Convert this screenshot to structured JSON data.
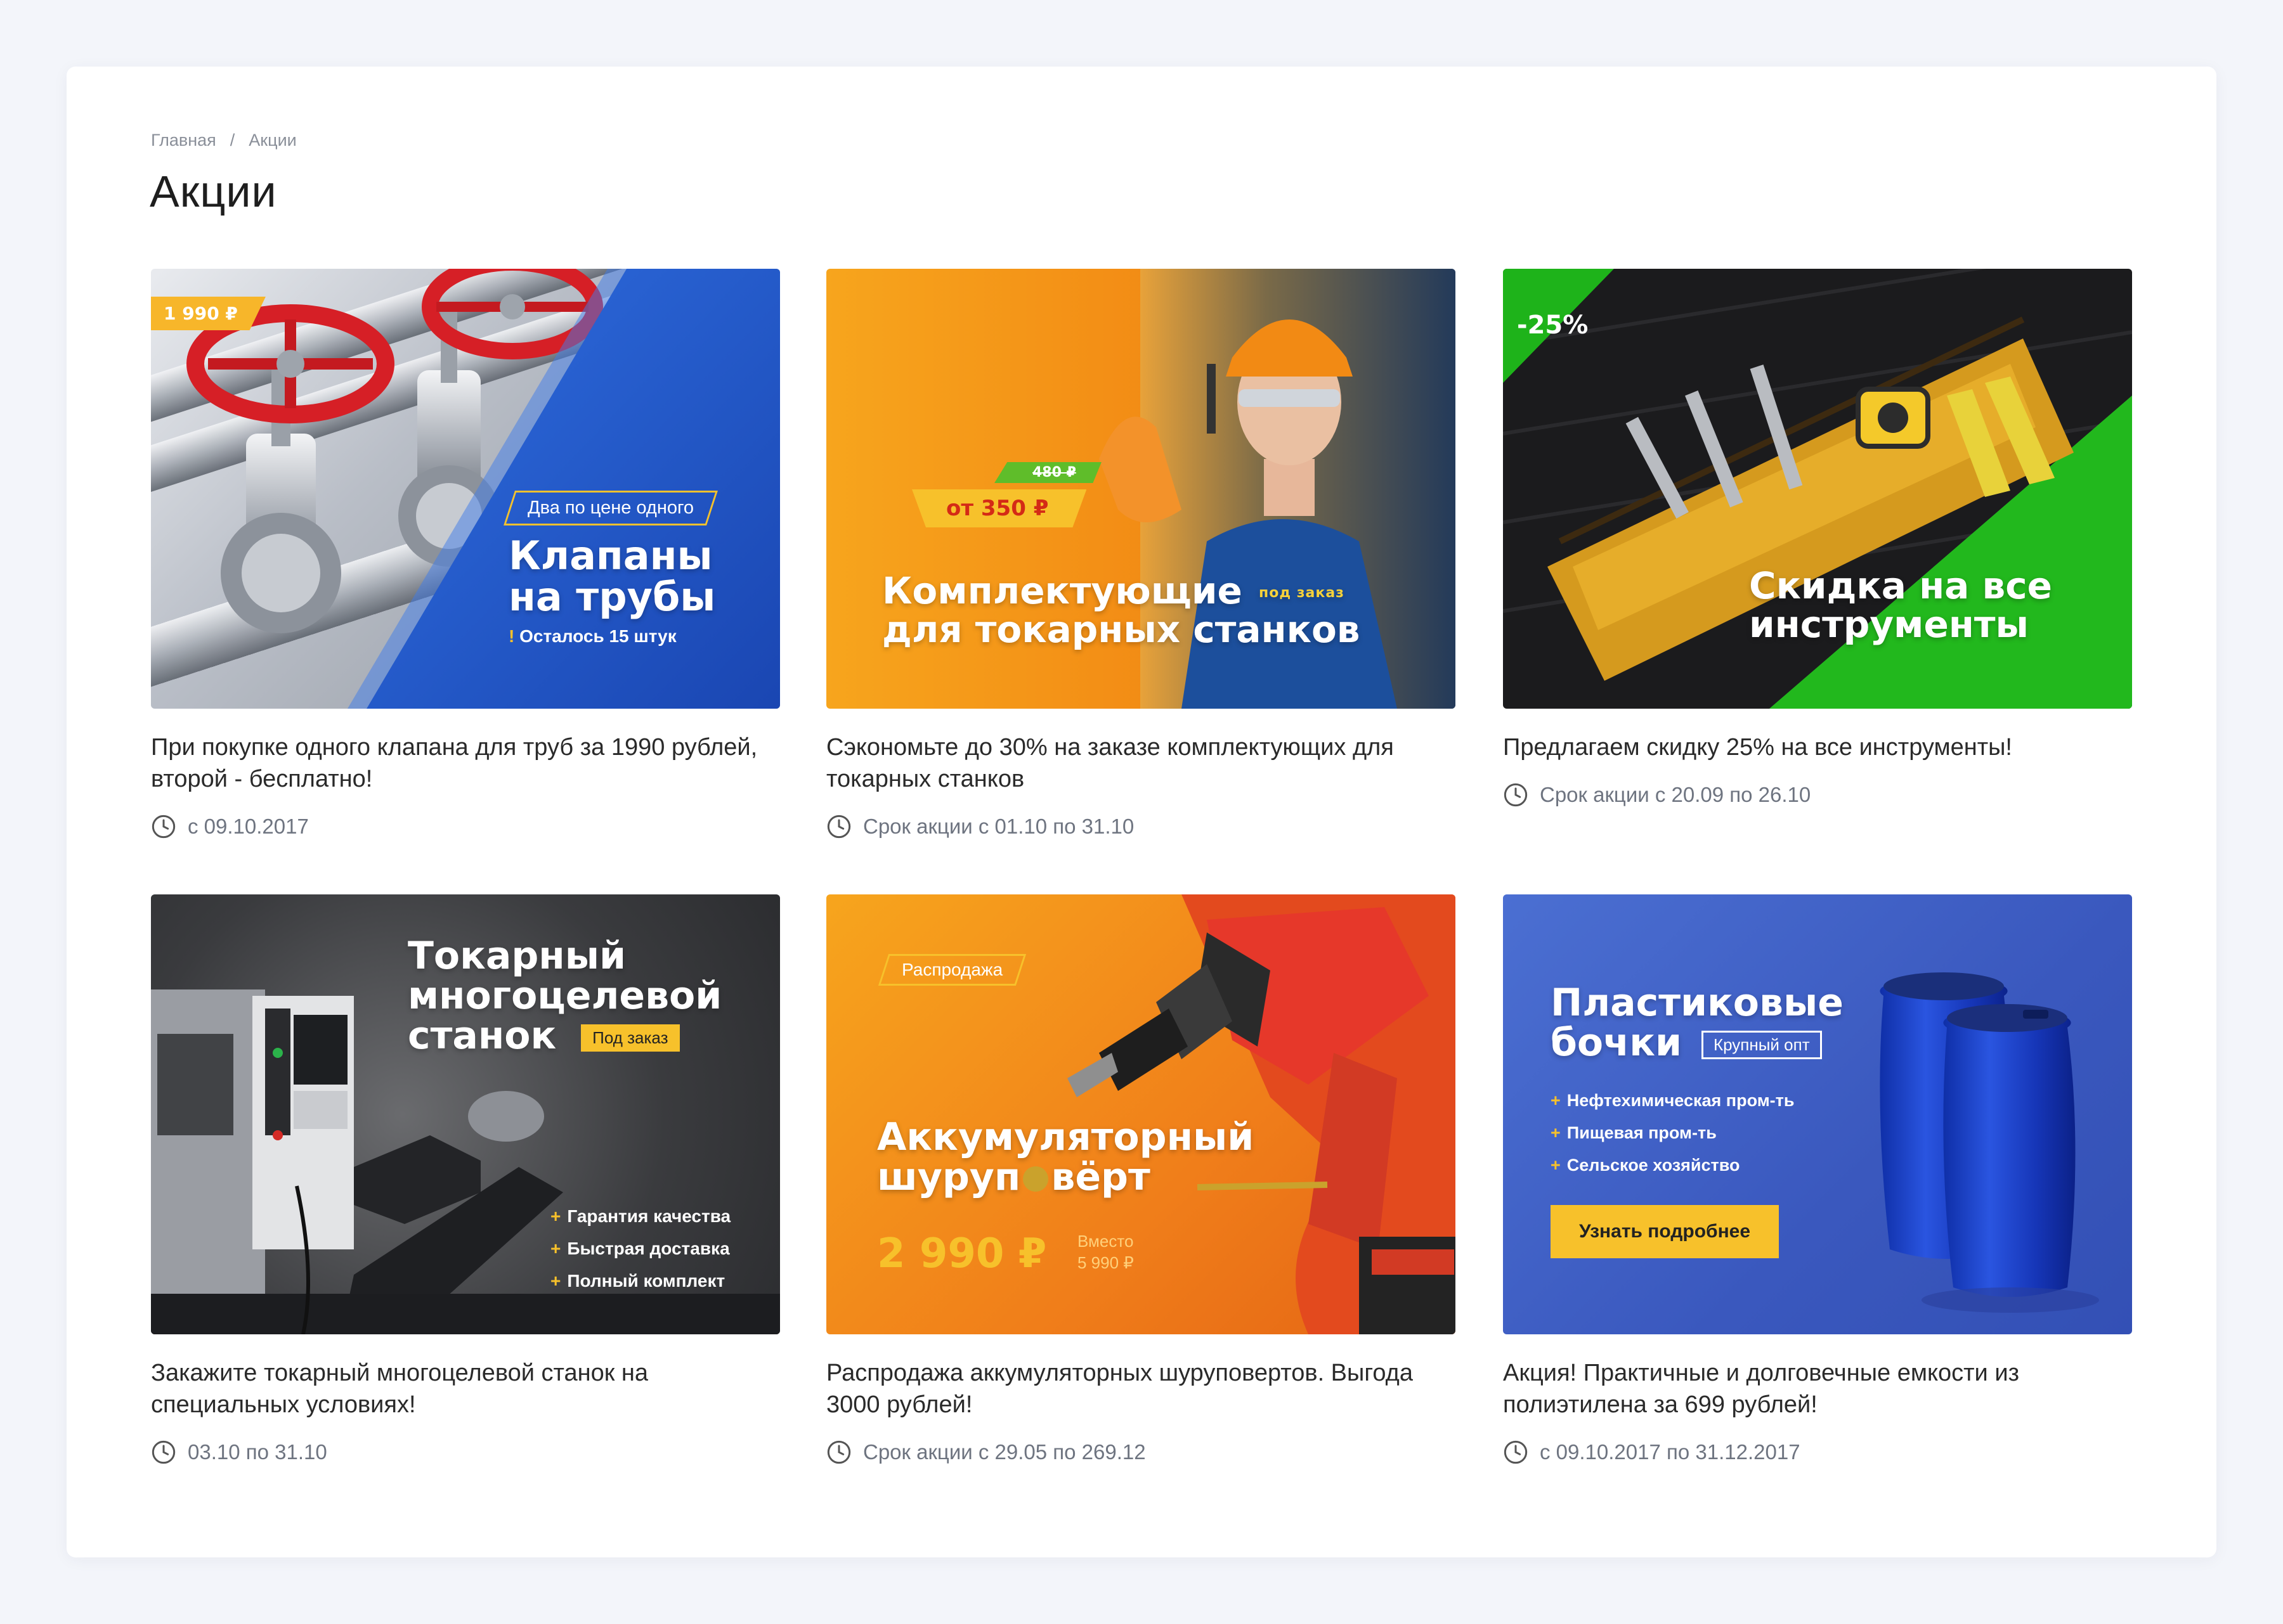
{
  "breadcrumb": {
    "home": "Главная",
    "separator": "/",
    "current": "Акции"
  },
  "page_title": "Акции",
  "promos": [
    {
      "banner": {
        "price_tag": "1 990 ₽",
        "badge": "Два по цене одного",
        "headline1": "Клапаны",
        "headline2": "на трубы",
        "note_mark": "!",
        "note": "Осталось 15 штук"
      },
      "description": "При покупке одного клапана для труб за 1990 рублей, второй - бесплатно!",
      "date": "с 09.10.2017"
    },
    {
      "banner": {
        "old_price": "480 ₽",
        "price": "от 350 ₽",
        "headline1": "Комплектующие",
        "order_tag": "под заказ",
        "headline2": "для токарных станков"
      },
      "description": "Сэкономьте до 30% на заказе комплектующих для токарных станков",
      "date": "Срок акции с 01.10 по 31.10"
    },
    {
      "banner": {
        "discount": "-25%",
        "headline1": "Скидка на все",
        "headline2": "инструменты"
      },
      "description": "Предлагаем скидку 25% на все инструменты!",
      "date": "Срок акции с 20.09 по 26.10"
    },
    {
      "banner": {
        "headline1": "Токарный",
        "headline2": "многоцелевой",
        "headline3": "станок",
        "order_tag": "Под заказ",
        "bullets": [
          "Гарантия качества",
          "Быстрая доставка",
          "Полный комплект"
        ]
      },
      "description": "Закажите токарный многоцелевой станок на специальных условиях!",
      "date": "03.10 по 31.10"
    },
    {
      "banner": {
        "badge": "Распродажа",
        "headline1": "Аккумуляторный",
        "headline2a": "шуруп",
        "headline2b": "вёрт",
        "price": "2 990 ₽",
        "instead_label": "Вместо",
        "instead_price": "5 990 ₽"
      },
      "description": "Распродажа аккумуляторных шуруповертов. Выгода 3000 рублей!",
      "date": "Срок акции с 29.05 по 269.12"
    },
    {
      "banner": {
        "headline1": "Пластиковые",
        "headline2": "бочки",
        "tag": "Крупный опт",
        "bullets": [
          "Нефтехимическая пром-ть",
          "Пищевая пром-ть",
          "Сельское хозяйство"
        ],
        "button": "Узнать подробнее"
      },
      "description": "Акция! Практичные и долговечные емкости из полиэтилена за 699 рублей!",
      "date": "с 09.10.2017 по 31.12.2017"
    }
  ],
  "colors": {
    "page_bg": "#f3f5fa",
    "accent_yellow": "#f7b62a",
    "blue_banner": "#1f58c9",
    "orange_banner": "#f39a1d",
    "green_banner": "#1eb31a",
    "barrel_banner": "#3b5dc4"
  }
}
